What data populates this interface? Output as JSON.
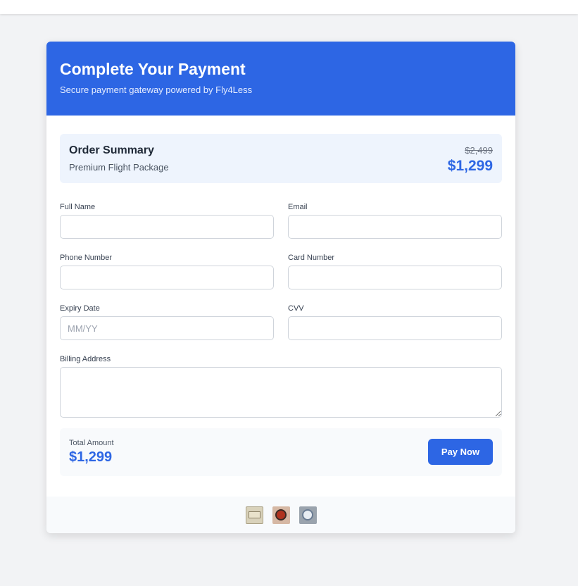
{
  "header": {
    "title": "Complete Your Payment",
    "subtitle": "Secure payment gateway powered by Fly4Less"
  },
  "summary": {
    "title": "Order Summary",
    "item": "Premium Flight Package",
    "original_price": "$2,499",
    "price": "$1,299"
  },
  "form": {
    "full_name": {
      "label": "Full Name",
      "value": "",
      "placeholder": ""
    },
    "email": {
      "label": "Email",
      "value": "",
      "placeholder": ""
    },
    "phone": {
      "label": "Phone Number",
      "value": "",
      "placeholder": ""
    },
    "card_number": {
      "label": "Card Number",
      "value": "",
      "placeholder": ""
    },
    "expiry": {
      "label": "Expiry Date",
      "value": "",
      "placeholder": "MM/YY"
    },
    "cvv": {
      "label": "CVV",
      "value": "",
      "placeholder": ""
    },
    "billing_address": {
      "label": "Billing Address",
      "value": "",
      "placeholder": ""
    }
  },
  "total": {
    "label": "Total Amount",
    "value": "$1,299",
    "pay_button": "Pay Now"
  },
  "footer": {
    "payment_icons": [
      "card-icon",
      "mastercard-icon",
      "amex-icon"
    ]
  },
  "colors": {
    "brand": "#2d66e4",
    "page_background": "#f2f3f5",
    "summary_background": "#eef4fd"
  }
}
